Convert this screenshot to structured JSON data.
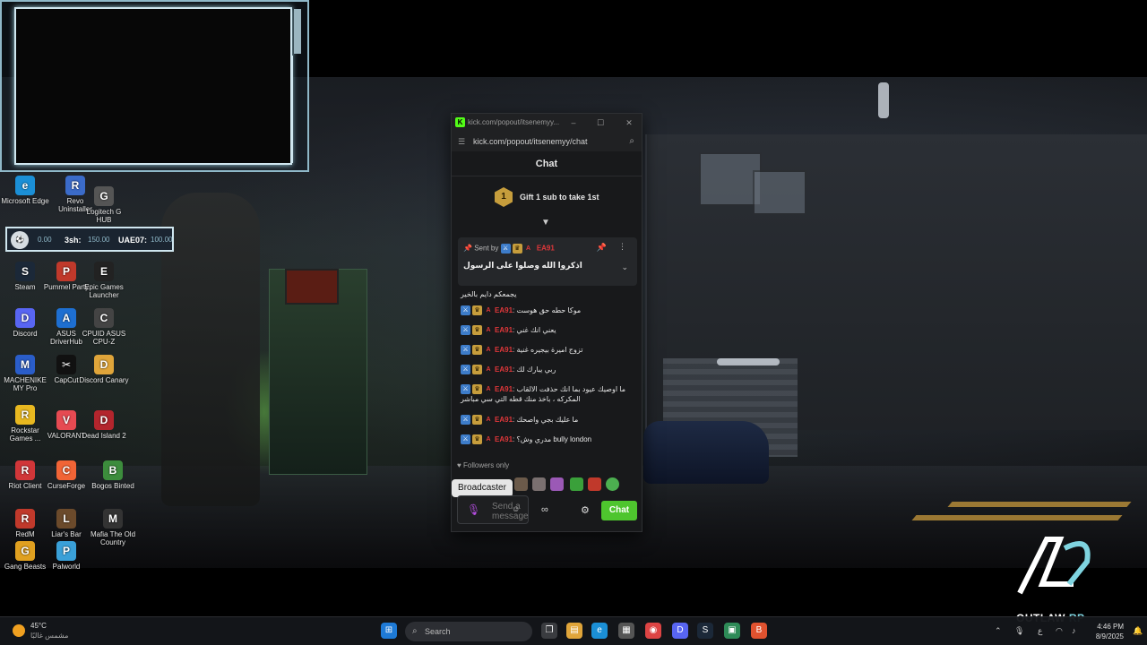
{
  "desktop": {
    "icons": [
      {
        "label": "Microsoft Edge",
        "color": "#1b8fd6",
        "glyph": "e"
      },
      {
        "label": "Revo Uninstaller",
        "color": "#3b6bc9",
        "glyph": "R"
      },
      {
        "label": "Logitech G HUB",
        "color": "#555555",
        "glyph": "G"
      },
      {
        "label": "Steam",
        "color": "#1b2838",
        "glyph": "S"
      },
      {
        "label": "Pummel Party",
        "color": "#c0392b",
        "glyph": "P"
      },
      {
        "label": "Epic Games Launcher",
        "color": "#222222",
        "glyph": "E"
      },
      {
        "label": "Discord",
        "color": "#5865f2",
        "glyph": "D"
      },
      {
        "label": "ASUS DriverHub",
        "color": "#1e6fd1",
        "glyph": "A"
      },
      {
        "label": "CPUID ASUS CPU-Z",
        "color": "#444444",
        "glyph": "C"
      },
      {
        "label": "MACHENIKE MY Pro",
        "color": "#2a5dc9",
        "glyph": "M"
      },
      {
        "label": "CapCut",
        "color": "#111111",
        "glyph": "✂"
      },
      {
        "label": "Discord Canary",
        "color": "#e0a53a",
        "glyph": "D"
      },
      {
        "label": "Rockstar Games ...",
        "color": "#e8b820",
        "glyph": "R"
      },
      {
        "label": "VALORANT",
        "color": "#e64a52",
        "glyph": "V"
      },
      {
        "label": "Dead Island 2",
        "color": "#b3252d",
        "glyph": "D"
      },
      {
        "label": "Riot Client",
        "color": "#d13639",
        "glyph": "R"
      },
      {
        "label": "CurseForge",
        "color": "#f16436",
        "glyph": "C"
      },
      {
        "label": "Bogos Binted",
        "color": "#3c8c3c",
        "glyph": "B"
      },
      {
        "label": "RedM",
        "color": "#c0392b",
        "glyph": "R"
      },
      {
        "label": "Liar's Bar",
        "color": "#6b4a2b",
        "glyph": "L"
      },
      {
        "label": "Mafia The Old Country",
        "color": "#333333",
        "glyph": "M"
      },
      {
        "label": "Gang Beasts",
        "color": "#e0a020",
        "glyph": "G"
      },
      {
        "label": "Palworld",
        "color": "#3aa0d8",
        "glyph": "P"
      }
    ]
  },
  "scorebar": {
    "left_score": "0.00",
    "team_left": "3sh:",
    "mid_score": "150.00",
    "team_right": "UAE07:",
    "right_score": "100.00"
  },
  "chat_window": {
    "title": "kick.com/popout/itsenemyy...",
    "url": "kick.com/popout/itsenemyy/chat",
    "header": "Chat",
    "gift_rank": "1",
    "gift_text": "Gift 1 sub to take 1st",
    "pinned": {
      "sent_by": "Sent by",
      "username": "EA91",
      "message": "اذكروا الله وصلوا على الرسول"
    },
    "partial_message": "يجمعكم دايم بالخير",
    "messages": [
      {
        "user": "EA91",
        "text": "موكا حطه حق هوست"
      },
      {
        "user": "EA91",
        "text": "يعني انك غني"
      },
      {
        "user": "EA91",
        "text": "تزوج اميرة بيجيره غنية"
      },
      {
        "user": "EA91",
        "text": "ربي يبارك لك"
      },
      {
        "user": "EA91",
        "text": "ما اوصيك عيود بما انك حذفت الالقاب المكركه ، باخذ منك قطه التي سي مباشر"
      },
      {
        "user": "EA91",
        "text": "ما عليك بجي واصحك"
      },
      {
        "user": "EA91",
        "text": "مدري وش؟ bully london"
      }
    ],
    "followers_only": "Followers only",
    "tooltip": "Broadcaster",
    "input_placeholder": "Send a message",
    "send_label": "Chat"
  },
  "logo": {
    "word1": "OUTLAW",
    "word2": "RP"
  },
  "taskbar": {
    "temperature": "45°C",
    "condition": "مشمس غالبًا",
    "search_placeholder": "Search",
    "time": "4:46 PM",
    "date": "8/9/2025",
    "lang": "ع"
  },
  "colors": {
    "kick_green": "#53fc18",
    "username_red": "#e0373a",
    "send_button": "#4ec52e"
  }
}
